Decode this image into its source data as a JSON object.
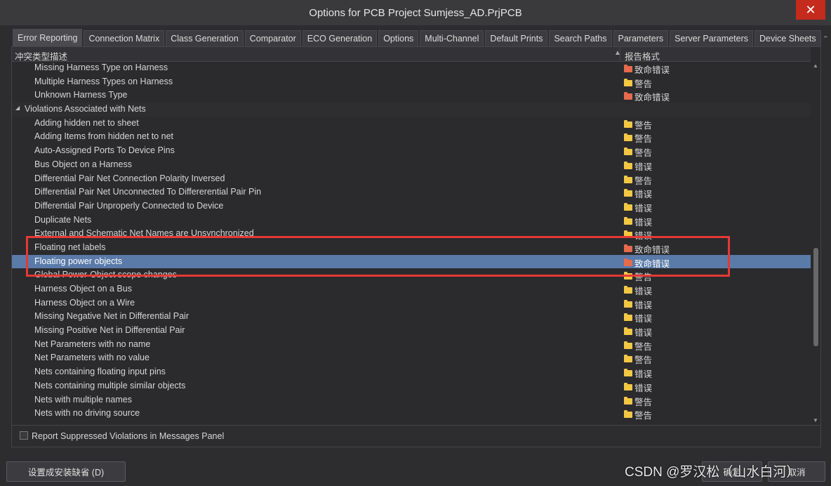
{
  "window": {
    "title": "Options for PCB Project Sumjess_AD.PrjPCB",
    "close_symbol": "✕"
  },
  "tabs": [
    "Error Reporting",
    "Connection Matrix",
    "Class Generation",
    "Comparator",
    "ECO Generation",
    "Options",
    "Multi-Channel",
    "Default Prints",
    "Search Paths",
    "Parameters",
    "Server Parameters",
    "Device Sheets"
  ],
  "tab_scroll": {
    "left": "⌃",
    "right": "⌄"
  },
  "table": {
    "col_description": "冲突类型描述",
    "col_report": "报告格式",
    "sort_arrow": "▲",
    "rows": [
      {
        "name": "Missing Harness Type on Harness",
        "report": "致命错误",
        "level": "fatal"
      },
      {
        "name": "Multiple Harness Types on Harness",
        "report": "警告",
        "level": "warning"
      },
      {
        "name": "Unknown Harness Type",
        "report": "致命错误",
        "level": "fatal"
      },
      {
        "name": "Violations Associated with Nets",
        "group": true,
        "toggle": "◢"
      },
      {
        "name": "Adding hidden net to sheet",
        "report": "警告",
        "level": "warning"
      },
      {
        "name": "Adding Items from hidden net to net",
        "report": "警告",
        "level": "warning"
      },
      {
        "name": "Auto-Assigned Ports To Device Pins",
        "report": "警告",
        "level": "warning"
      },
      {
        "name": "Bus Object on a Harness",
        "report": "错误",
        "level": "error"
      },
      {
        "name": "Differential Pair Net Connection Polarity Inversed",
        "report": "警告",
        "level": "warning"
      },
      {
        "name": "Differential Pair Net Unconnected To Differerential Pair Pin",
        "report": "错误",
        "level": "error"
      },
      {
        "name": "Differential Pair Unproperly Connected to Device",
        "report": "错误",
        "level": "error"
      },
      {
        "name": "Duplicate Nets",
        "report": "错误",
        "level": "error"
      },
      {
        "name": "External and Schematic Net Names are Unsynchronized",
        "report": "错误",
        "level": "error"
      },
      {
        "name": "Floating net labels",
        "report": "致命错误",
        "level": "fatal"
      },
      {
        "name": "Floating power objects",
        "report": "致命错误",
        "level": "fatal",
        "selected": true
      },
      {
        "name": "Global Power-Object scope changes",
        "report": "警告",
        "level": "warning"
      },
      {
        "name": "Harness Object on a Bus",
        "report": "错误",
        "level": "error"
      },
      {
        "name": "Harness Object on a Wire",
        "report": "错误",
        "level": "error"
      },
      {
        "name": "Missing Negative Net in Differential Pair",
        "report": "错误",
        "level": "error"
      },
      {
        "name": "Missing Positive Net in Differential Pair",
        "report": "错误",
        "level": "error"
      },
      {
        "name": "Net Parameters with no name",
        "report": "警告",
        "level": "warning"
      },
      {
        "name": "Net Parameters with no value",
        "report": "警告",
        "level": "warning"
      },
      {
        "name": "Nets containing floating input pins",
        "report": "错误",
        "level": "error"
      },
      {
        "name": "Nets containing multiple similar objects",
        "report": "错误",
        "level": "error"
      },
      {
        "name": "Nets with multiple names",
        "report": "警告",
        "level": "warning"
      },
      {
        "name": "Nets with no driving source",
        "report": "警告",
        "level": "warning"
      }
    ]
  },
  "scroll": {
    "up": "▲",
    "down": "▼"
  },
  "options": {
    "report_suppressed": "Report Suppressed Violations in Messages Panel",
    "checked": false
  },
  "footer": {
    "default_button": "设置成安装缺省 (D)",
    "ok_button": "确定",
    "cancel_button": "取消"
  },
  "watermark": "CSDN @罗汉松（山水白河）",
  "colors": {
    "selected_row": "#5a7aa8",
    "highlight_box": "#e53935",
    "folder_warning": "#f2c744",
    "folder_fatal": "#e66a4c"
  }
}
